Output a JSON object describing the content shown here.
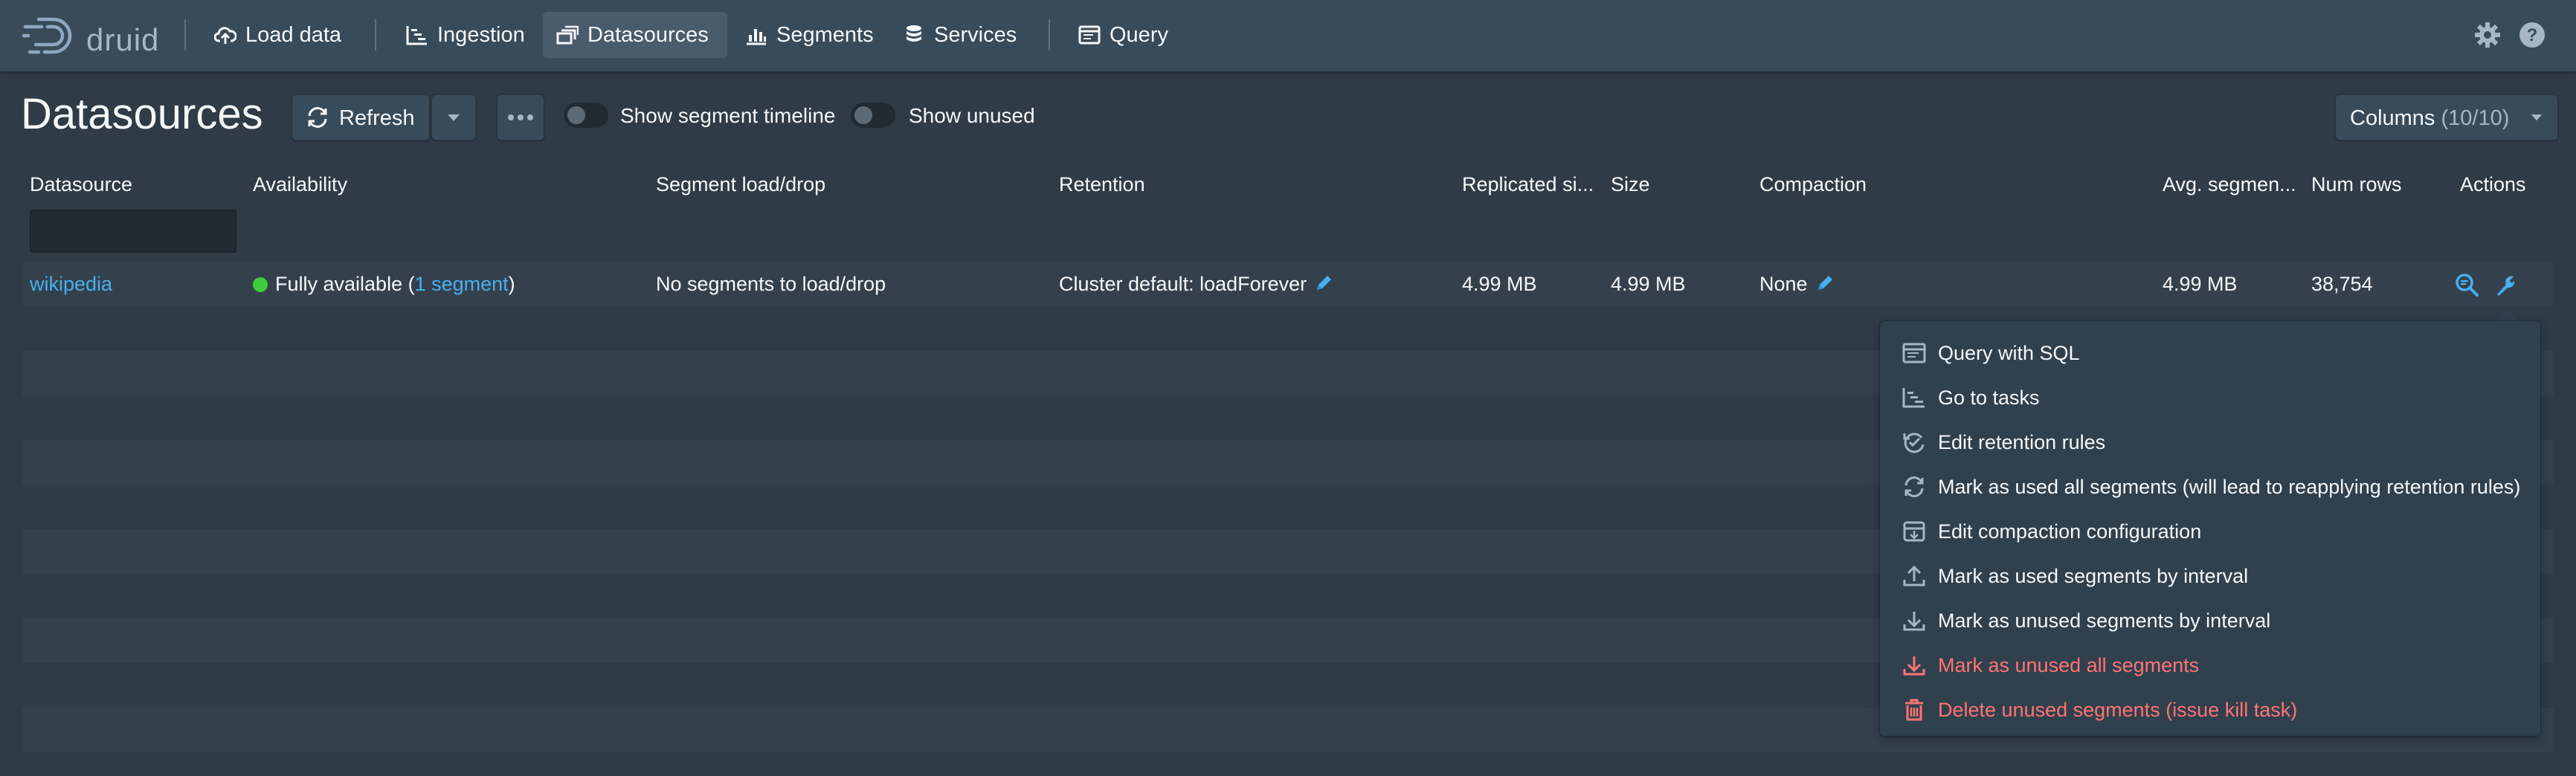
{
  "nav": {
    "brand": "druid",
    "items": [
      {
        "label": "Load data",
        "icon": "cloud-upload-icon"
      },
      {
        "label": "Ingestion",
        "icon": "gantt-chart-icon"
      },
      {
        "label": "Datasources",
        "icon": "multi-select-icon",
        "active": true
      },
      {
        "label": "Segments",
        "icon": "stacked-chart-icon"
      },
      {
        "label": "Services",
        "icon": "database-icon"
      },
      {
        "label": "Query",
        "icon": "application-icon"
      }
    ],
    "right_icons": [
      "cog-icon",
      "help-icon"
    ]
  },
  "header": {
    "title": "Datasources",
    "refresh_label": "Refresh",
    "switch_timeline_label": "Show segment timeline",
    "switch_unused_label": "Show unused",
    "columns_label": "Columns",
    "columns_count": "(10/10)"
  },
  "table": {
    "columns": [
      "Datasource",
      "Availability",
      "Segment load/drop",
      "Retention",
      "Replicated si...",
      "Size",
      "Compaction",
      "Avg. segmen...",
      "Num rows",
      "Actions"
    ],
    "rows": [
      {
        "datasource": "wikipedia",
        "availability_prefix": "Fully available (",
        "availability_link": "1 segment",
        "availability_suffix": ")",
        "load_drop": "No segments to load/drop",
        "retention": "Cluster default: loadForever",
        "replicated_size": "4.99 MB",
        "size": "4.99 MB",
        "compaction": "None",
        "avg_segment": "4.99 MB",
        "num_rows": "38,754"
      }
    ]
  },
  "actions_menu": {
    "items": [
      {
        "label": "Query with SQL",
        "icon": "application-icon",
        "danger": false
      },
      {
        "label": "Go to tasks",
        "icon": "gantt-chart-icon",
        "danger": false
      },
      {
        "label": "Edit retention rules",
        "icon": "automatic-updates-icon",
        "danger": false
      },
      {
        "label": "Mark as used all segments (will lead to reapplying retention rules)",
        "icon": "refresh-icon",
        "danger": false
      },
      {
        "label": "Edit compaction configuration",
        "icon": "compressed-icon",
        "danger": false
      },
      {
        "label": "Mark as used segments by interval",
        "icon": "upload-icon",
        "danger": false
      },
      {
        "label": "Mark as unused segments by interval",
        "icon": "download-icon",
        "danger": false
      },
      {
        "label": "Mark as unused all segments",
        "icon": "download-icon",
        "danger": true
      },
      {
        "label": "Delete unused segments (issue kill task)",
        "icon": "trash-icon",
        "danger": true
      }
    ]
  },
  "colors": {
    "nav_bg": "#394b59",
    "page_bg": "#2f3b47",
    "link": "#48aff0",
    "success": "#3dcc3d",
    "danger": "#ff7373"
  }
}
